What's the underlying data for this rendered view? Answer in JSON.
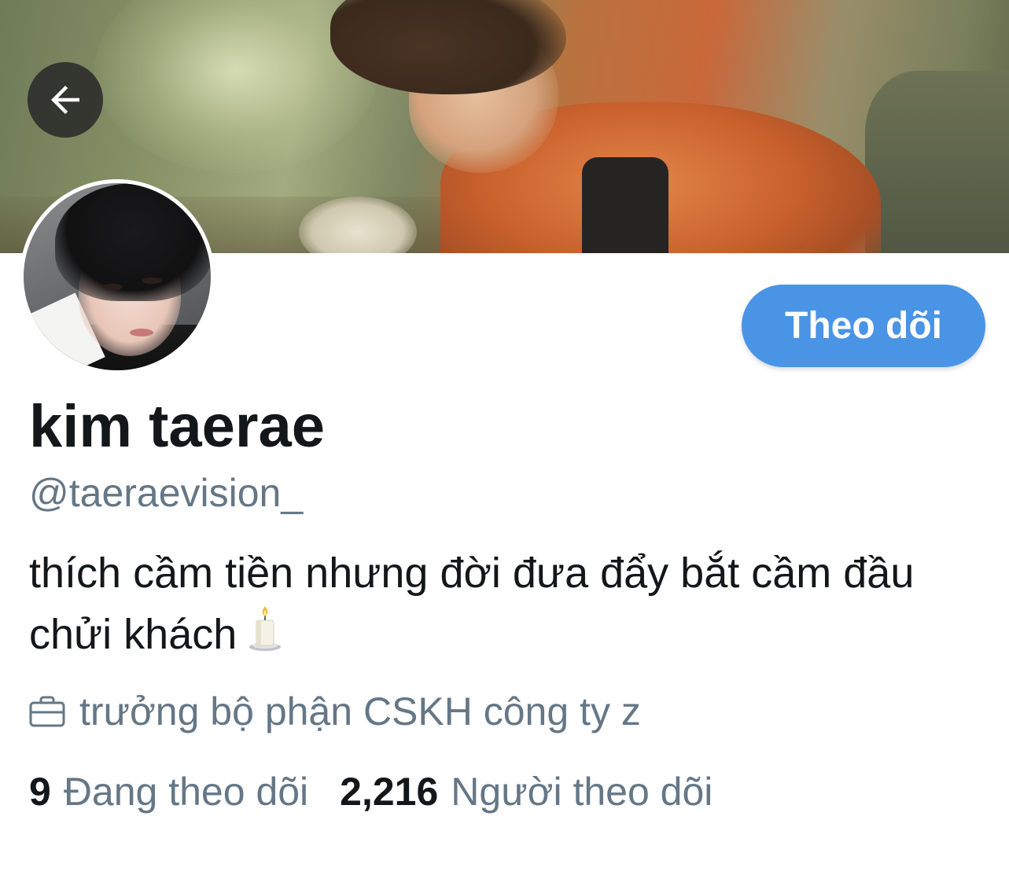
{
  "profile": {
    "display_name": "kim taerae",
    "handle": "@taeraevision_",
    "bio": "thích cầm tiền nhưng đời đưa đẩy bắt cầm đầu chửi khách",
    "bio_emoji": "candle",
    "work": "trưởng bộ phận CSKH công ty z"
  },
  "actions": {
    "follow_label": "Theo dõi",
    "back_icon": "arrow-left-icon"
  },
  "stats": {
    "following_count": "9",
    "following_label": "Đang theo dõi",
    "followers_count": "2,216",
    "followers_label": "Người theo dõi"
  },
  "colors": {
    "accent": "#4a94e6",
    "text_primary": "#14171a",
    "text_secondary": "#657786"
  }
}
